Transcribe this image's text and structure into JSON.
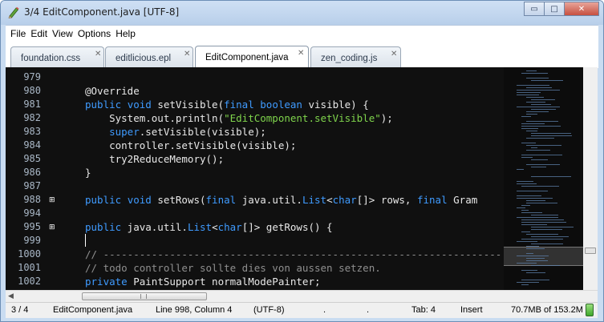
{
  "window": {
    "title": "3/4  EditComponent.java [UTF-8]",
    "controls": {
      "minimize": "▭",
      "maximize": "□",
      "close": "✕"
    }
  },
  "menu": [
    "File",
    "Edit",
    "View",
    "Options",
    "Help"
  ],
  "tabs": [
    {
      "label": "foundation.css",
      "active": false
    },
    {
      "label": "editlicious.epl",
      "active": false
    },
    {
      "label": "EditComponent.java",
      "active": true
    },
    {
      "label": "zen_coding.js",
      "active": false
    }
  ],
  "editor": {
    "line_numbers": [
      "979",
      "980",
      "981",
      "982",
      "983",
      "984",
      "985",
      "986",
      "987",
      "988",
      "994",
      "995",
      "999",
      "1000",
      "1001",
      "1002"
    ],
    "fold_markers": {
      "988": "⊞",
      "995": "⊞"
    },
    "code": {
      "l980_ann": "@Override",
      "l981_kw1": "public",
      "l981_kw2": "void",
      "l981_txt1": " setVisible(",
      "l981_kw3": "final",
      "l981_kw4": "boolean",
      "l981_txt2": " visible) {",
      "l982_txt1": "    System.out.println(",
      "l982_str": "\"EditComponent.setVisible\"",
      "l982_txt2": ");",
      "l983_kw": "    super",
      "l983_txt": ".setVisible(visible);",
      "l984_txt": "    controller.setVisible(visible);",
      "l985_txt": "    try2ReduceMemory();",
      "l986_txt": "}",
      "l988_kw1": "public",
      "l988_kw2": "void",
      "l988_txt1": " setRows(",
      "l988_kw3": "final",
      "l988_txt2": " java.util.",
      "l988_kw4": "List",
      "l988_txt3": "<",
      "l988_kw5": "char",
      "l988_txt4": "[]> rows, ",
      "l988_kw6": "final",
      "l988_txt5": " Gram",
      "l995_kw1": "public",
      "l995_txt1": " java.util.",
      "l995_kw2": "List",
      "l995_txt2": "<",
      "l995_kw3": "char",
      "l995_txt3": "[]> getRows() {",
      "l1000_cm": "// ------------------------------------------------------------------",
      "l1001_cm": "// todo controller sollte dies von aussen setzen.",
      "l1002_kw": "private",
      "l1002_txt": " PaintSupport normalModePainter;"
    }
  },
  "status": {
    "position": "3 / 4",
    "file": "EditComponent.java",
    "cursor": "Line 998, Column 4",
    "encoding": "(UTF-8)",
    "dot1": ".",
    "dot2": ".",
    "tab": "Tab: 4",
    "mode": "Insert",
    "memory": "70.7MB of 153.2M"
  },
  "colors": {
    "editor_bg": "#101010",
    "keyword": "#3f9bff",
    "string": "#7fd44c",
    "comment": "#8f8f8f",
    "line_number": "#a9b7c6"
  }
}
